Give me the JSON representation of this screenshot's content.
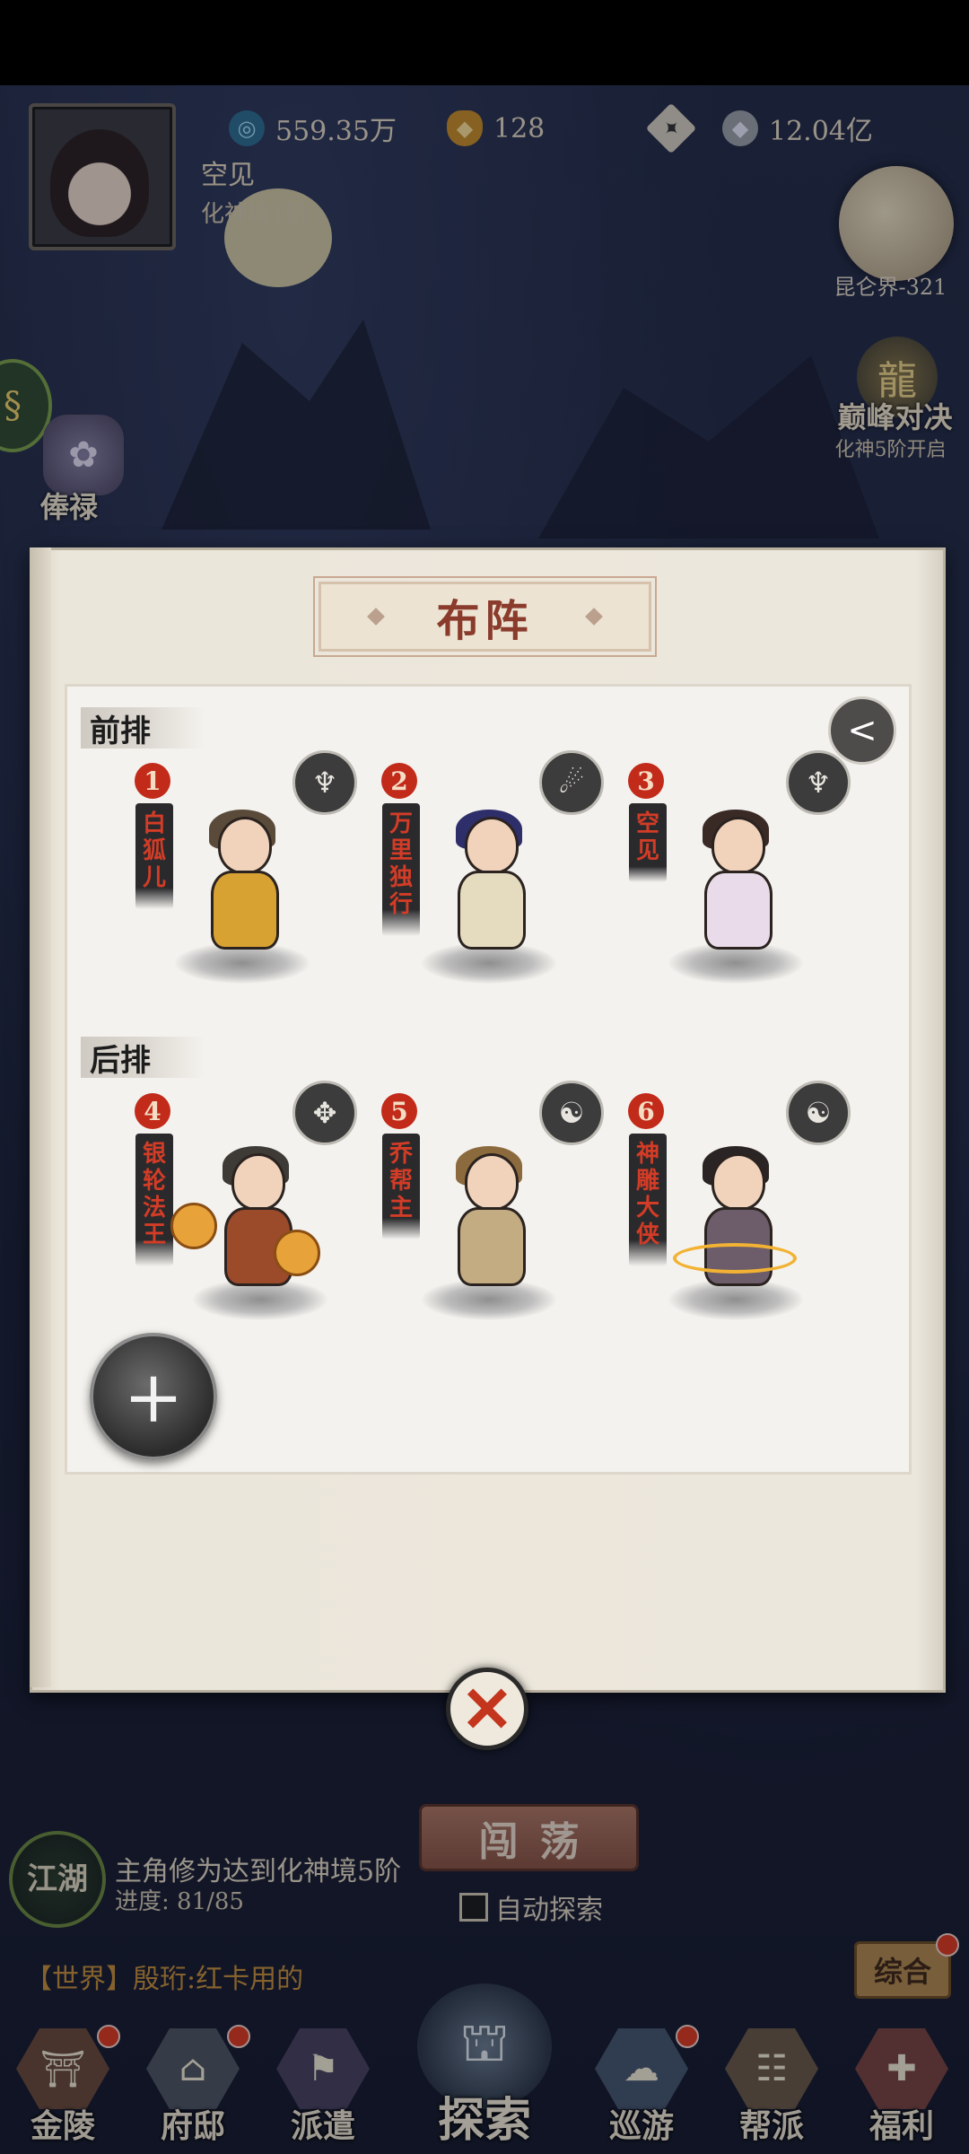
{
  "player": {
    "name": "空见",
    "realm": "化神境1阶"
  },
  "resources": {
    "spirit": "559.35万",
    "gold": "128",
    "silver": "12.04亿"
  },
  "world": {
    "label": "昆仑界-321"
  },
  "duel": {
    "title": "巅峰对决",
    "subtitle": "化神5阶开启"
  },
  "side": {
    "salary_label": "俸禄"
  },
  "formation": {
    "title": "布阵",
    "front_label": "前排",
    "back_label": "后排",
    "slots": [
      {
        "num": "1",
        "name": "白狐儿",
        "class_icon": "trident-emblem-icon"
      },
      {
        "num": "2",
        "name": "万里独行",
        "class_icon": "swirl-emblem-icon"
      },
      {
        "num": "3",
        "name": "空见",
        "class_icon": "trident-emblem-icon"
      },
      {
        "num": "4",
        "name": "银轮法王",
        "class_icon": "wings-emblem-icon"
      },
      {
        "num": "5",
        "name": "乔帮主",
        "class_icon": "yinyang-emblem-icon"
      },
      {
        "num": "6",
        "name": "神雕大侠",
        "class_icon": "yinyang-emblem-icon"
      }
    ],
    "add_symbol": "+",
    "close_symbol": "✕"
  },
  "explore": {
    "button": "闯荡",
    "auto_label": "自动探索"
  },
  "quest": {
    "emblem": "江湖",
    "title": "主角修为达到化神境5阶",
    "progress": "进度: 81/85"
  },
  "chat": {
    "line": "【世界】殷珩:红卡用的",
    "composite": "综合"
  },
  "nav": [
    {
      "label": "金陵",
      "icon": "palace-icon"
    },
    {
      "label": "府邸",
      "icon": "mansion-icon"
    },
    {
      "label": "派遣",
      "icon": "dispatch-icon"
    },
    {
      "label": "探索",
      "icon": "pavilion-icon"
    },
    {
      "label": "巡游",
      "icon": "travel-icon"
    },
    {
      "label": "帮派",
      "icon": "guild-icon"
    },
    {
      "label": "福利",
      "icon": "gift-icon"
    }
  ],
  "colors": {
    "accent_red": "#c22a1a",
    "panel": "#ece7dc",
    "chat_gold": "#c8913a"
  }
}
